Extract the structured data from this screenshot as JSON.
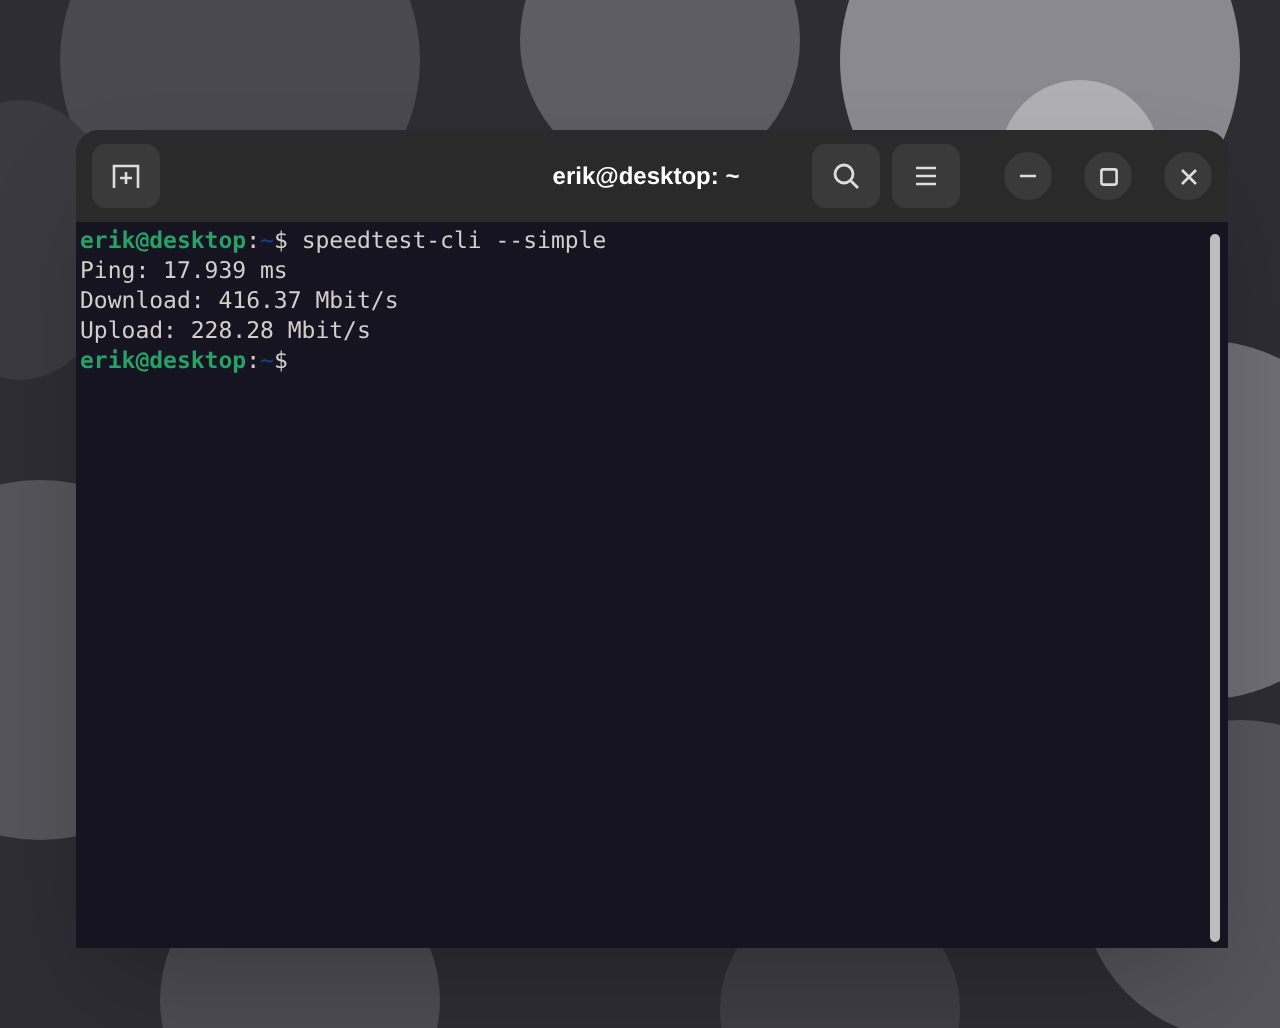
{
  "window": {
    "title": "erik@desktop: ~"
  },
  "terminal": {
    "lines": [
      {
        "kind": "prompt",
        "user_host": "erik@desktop",
        "separator": ":",
        "path": "~",
        "symbol": "$",
        "command": "speedtest-cli --simple"
      },
      {
        "kind": "output",
        "text": "Ping: 17.939 ms"
      },
      {
        "kind": "output",
        "text": "Download: 416.37 Mbit/s"
      },
      {
        "kind": "output",
        "text": "Upload: 228.28 Mbit/s"
      },
      {
        "kind": "prompt",
        "user_host": "erik@desktop",
        "separator": ":",
        "path": "~",
        "symbol": "$"
      }
    ]
  }
}
